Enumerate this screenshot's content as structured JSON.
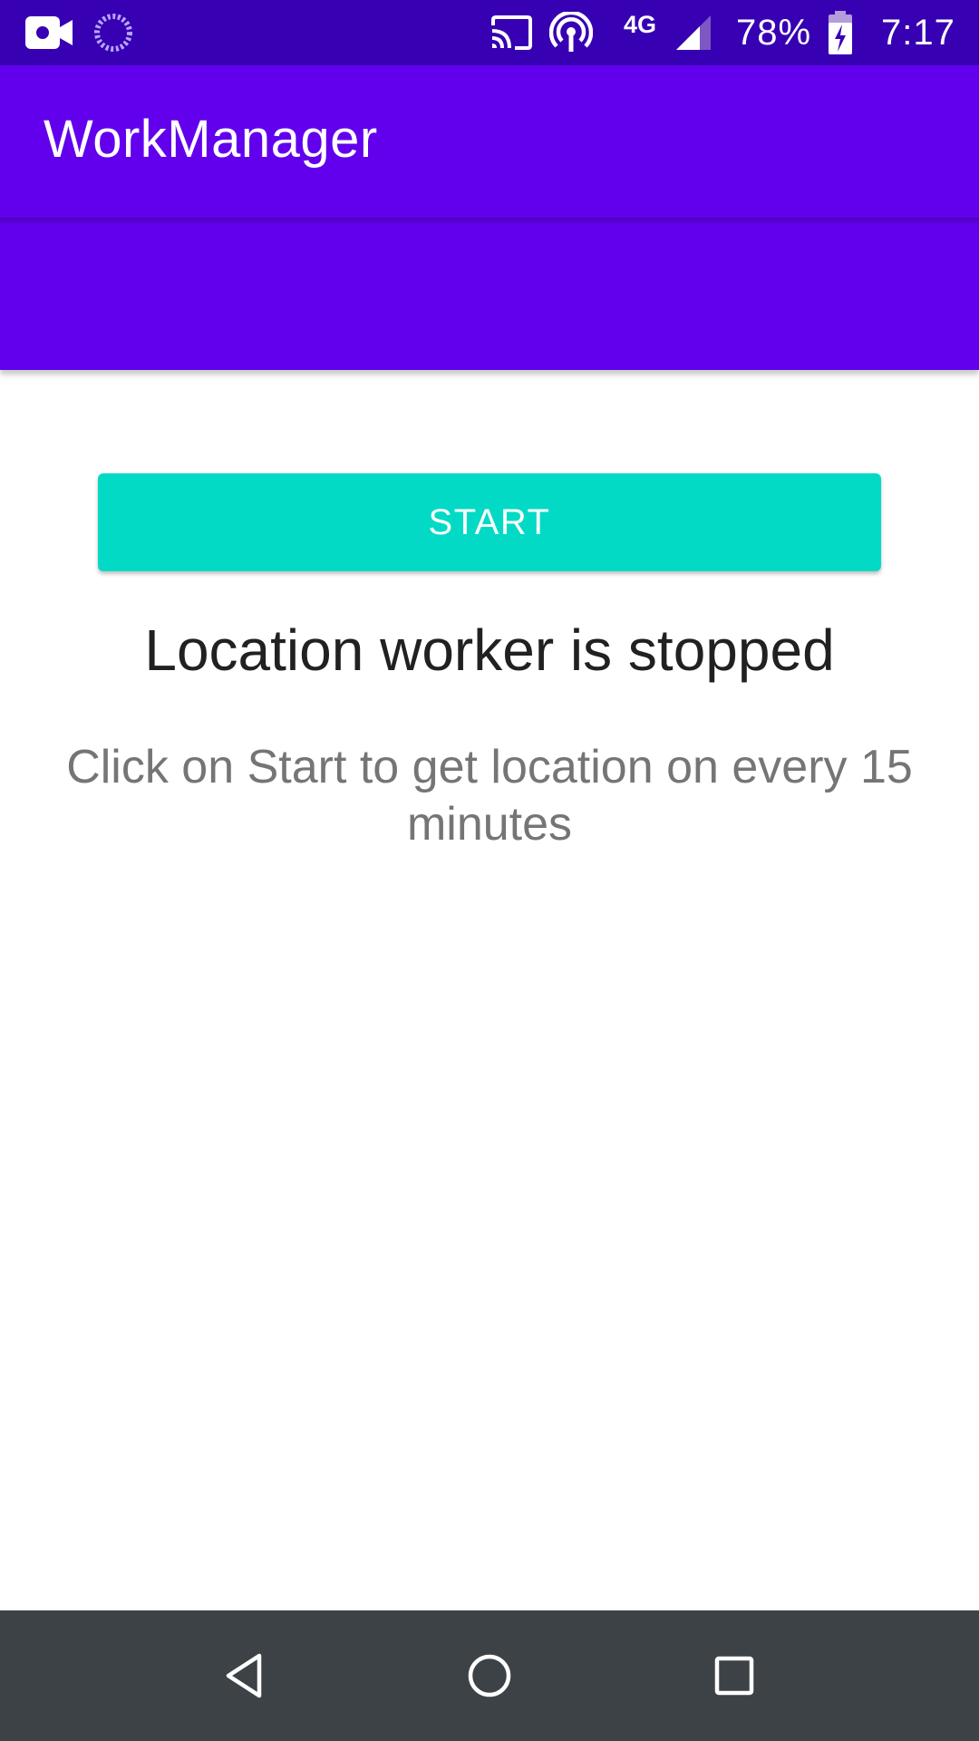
{
  "status_bar": {
    "network": "4G",
    "battery": "78%",
    "time": "7:17",
    "icons": [
      "video-camera-icon",
      "sync-icon",
      "cast-icon",
      "hotspot-icon",
      "signal-icon",
      "battery-charging-icon"
    ]
  },
  "app_bar": {
    "title": "WorkManager",
    "color": "#6200ee"
  },
  "main": {
    "start_button_label": "START",
    "start_button_color": "#03dac5",
    "status_title": "Location worker is stopped",
    "status_description": "Click on Start to get location on every 15 minutes"
  },
  "nav_bar": {
    "icons": [
      "back-icon",
      "home-icon",
      "recents-icon"
    ]
  }
}
